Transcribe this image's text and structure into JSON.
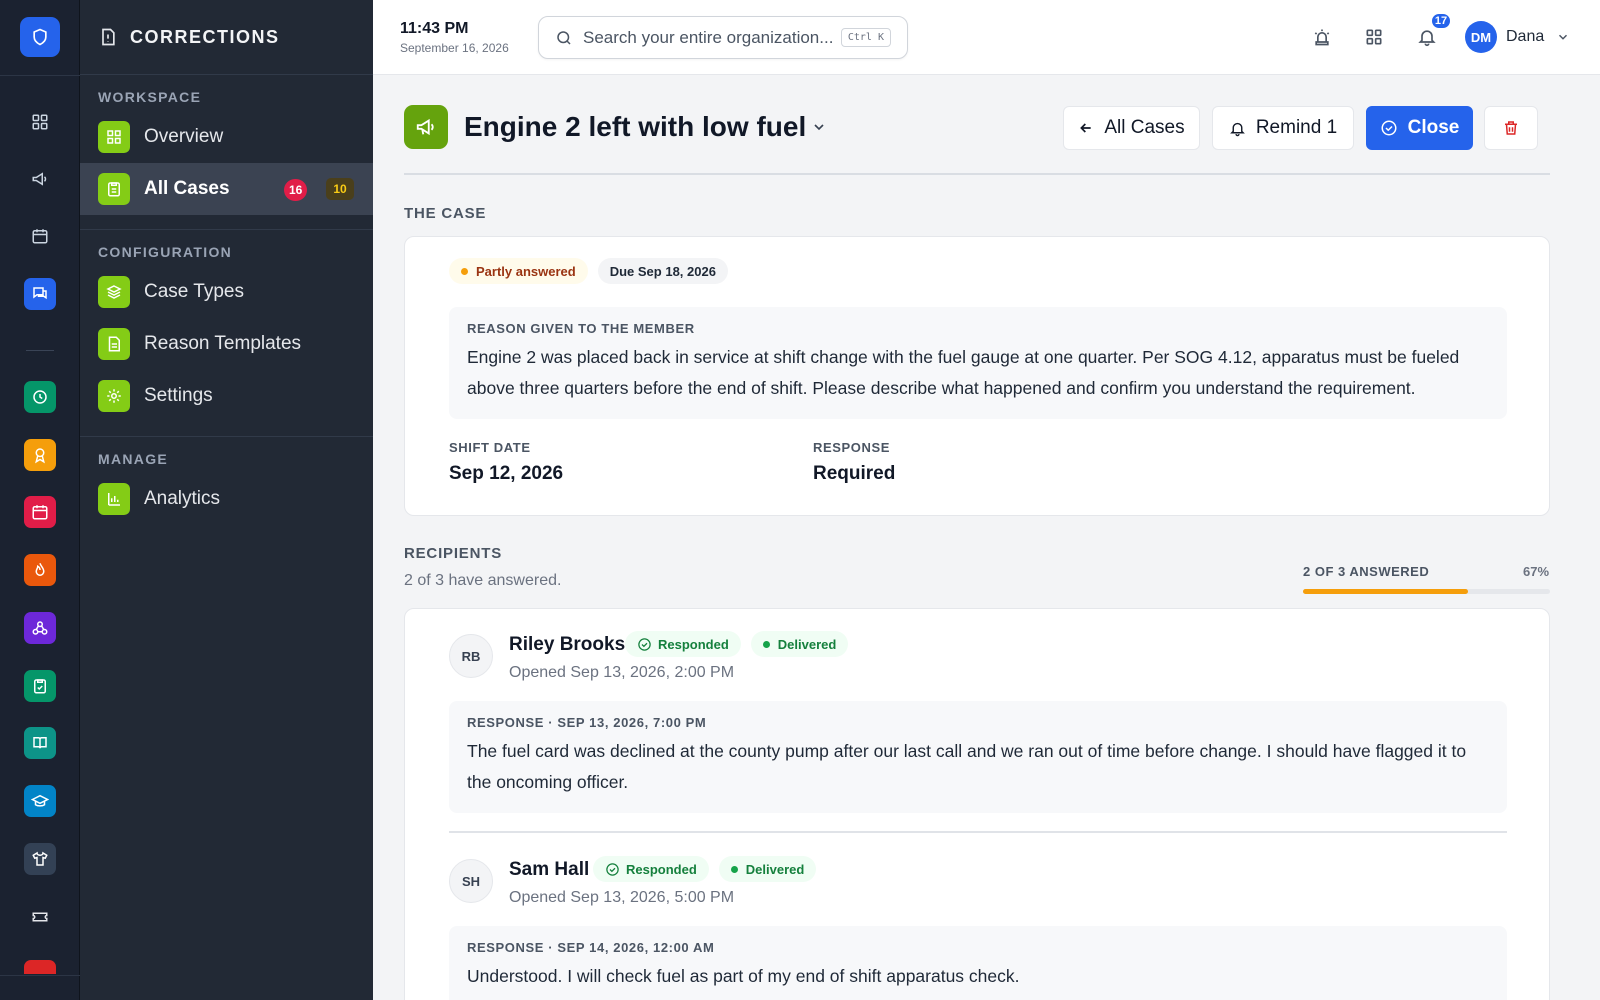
{
  "app": {
    "section_title": "CORRECTIONS"
  },
  "colors": {
    "accent": "#2563eb",
    "lime": "#84cc16",
    "amber": "#f59e0b",
    "danger": "#dc2626"
  },
  "topbar": {
    "time": "11:43 PM",
    "date": "September 16, 2026",
    "search_placeholder": "Search your entire organization...",
    "search_shortcut": "Ctrl K",
    "notifications_count": "17",
    "user_initials": "DM",
    "user_name": "Dana"
  },
  "sidebar": {
    "workspace_label": "WORKSPACE",
    "overview": "Overview",
    "all_cases": "All Cases",
    "all_cases_badge_red": "16",
    "all_cases_badge_amber": "10",
    "configuration_label": "CONFIGURATION",
    "case_types": "Case Types",
    "reason_templates": "Reason Templates",
    "settings": "Settings",
    "manage_label": "MANAGE",
    "analytics": "Analytics"
  },
  "header": {
    "title": "Engine 2 left with low fuel",
    "all_cases_btn": "All Cases",
    "remind_btn": "Remind 1",
    "close_btn": "Close"
  },
  "case": {
    "section_label": "THE CASE",
    "status": "Partly answered",
    "due": "Due Sep 18, 2026",
    "reason_label": "REASON GIVEN TO THE MEMBER",
    "reason_text": "Engine 2 was placed back in service at shift change with the fuel gauge at one quarter. Per SOG 4.12, apparatus must be fueled above three quarters before the end of shift. Please describe what happened and confirm you understand the requirement.",
    "shift_date_label": "SHIFT DATE",
    "shift_date": "Sep 12, 2026",
    "response_label": "RESPONSE",
    "response": "Required"
  },
  "recipients": {
    "section_label": "RECIPIENTS",
    "summary": "2 of 3 have answered.",
    "progress_label": "2 OF 3 ANSWERED",
    "progress_pct": "67%",
    "progress_fraction": 0.67,
    "items": [
      {
        "initials": "RB",
        "name": "Riley Brooks",
        "status": "Responded",
        "delivery": "Delivered",
        "opened": "Opened Sep 13, 2026, 2:00 PM",
        "response_label": "RESPONSE · SEP 13, 2026, 7:00 PM",
        "response_text": "The fuel card was declined at the county pump after our last call and we ran out of time before change. I should have flagged it to the oncoming officer."
      },
      {
        "initials": "SH",
        "name": "Sam Hall",
        "status": "Responded",
        "delivery": "Delivered",
        "opened": "Opened Sep 13, 2026, 5:00 PM",
        "response_label": "RESPONSE · SEP 14, 2026, 12:00 AM",
        "response_text": "Understood. I will check fuel as part of my end of shift apparatus check."
      }
    ]
  }
}
